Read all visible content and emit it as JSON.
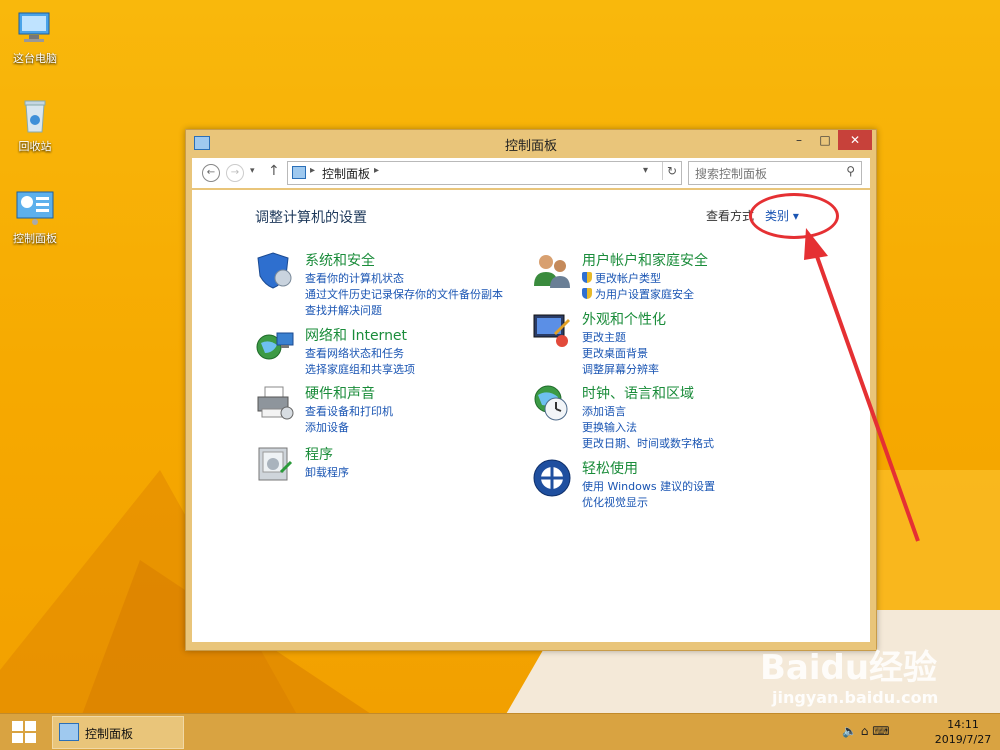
{
  "desktop": {
    "icons": [
      {
        "label": "这台电脑"
      },
      {
        "label": "回收站"
      },
      {
        "label": "控制面板"
      }
    ]
  },
  "window": {
    "title": "控制面板",
    "controls": {
      "minimize": "–",
      "maximize": "□",
      "close": "✕"
    },
    "nav": {
      "back": "←",
      "forward": "→",
      "recent": "▾",
      "up": "↑",
      "breadcrumb": "控制面板",
      "search_placeholder": "搜索控制面板"
    },
    "heading": "调整计算机的设置",
    "view_by_label": "查看方式",
    "view_by_value": "类别 ▾",
    "categories": [
      {
        "title": "系统和安全",
        "links": [
          "查看你的计算机状态",
          "通过文件历史记录保存你的文件备份副本",
          "查找并解决问题"
        ]
      },
      {
        "title": "网络和 Internet",
        "links": [
          "查看网络状态和任务",
          "选择家庭组和共享选项"
        ]
      },
      {
        "title": "硬件和声音",
        "links": [
          "查看设备和打印机",
          "添加设备"
        ]
      },
      {
        "title": "程序",
        "links": [
          "卸载程序"
        ]
      },
      {
        "title": "用户帐户和家庭安全",
        "links": [
          "更改帐户类型",
          "为用户设置家庭安全"
        ]
      },
      {
        "title": "外观和个性化",
        "links": [
          "更改主题",
          "更改桌面背景",
          "调整屏幕分辨率"
        ]
      },
      {
        "title": "时钟、语言和区域",
        "links": [
          "添加语言",
          "更换输入法",
          "更改日期、时间或数字格式"
        ]
      },
      {
        "title": "轻松使用",
        "links": [
          "使用 Windows 建议的设置",
          "优化视觉显示"
        ]
      }
    ]
  },
  "taskbar": {
    "item_label": "控制面板",
    "time": "14:11",
    "date": "2019/7/27"
  },
  "watermark": {
    "brand": "Baidu经验",
    "url": "jingyan.baidu.com"
  },
  "colors": {
    "accent_close": "#c7413a",
    "link": "#1a55b3",
    "category_title": "#1a8c3a",
    "annotation": "#e53033"
  }
}
